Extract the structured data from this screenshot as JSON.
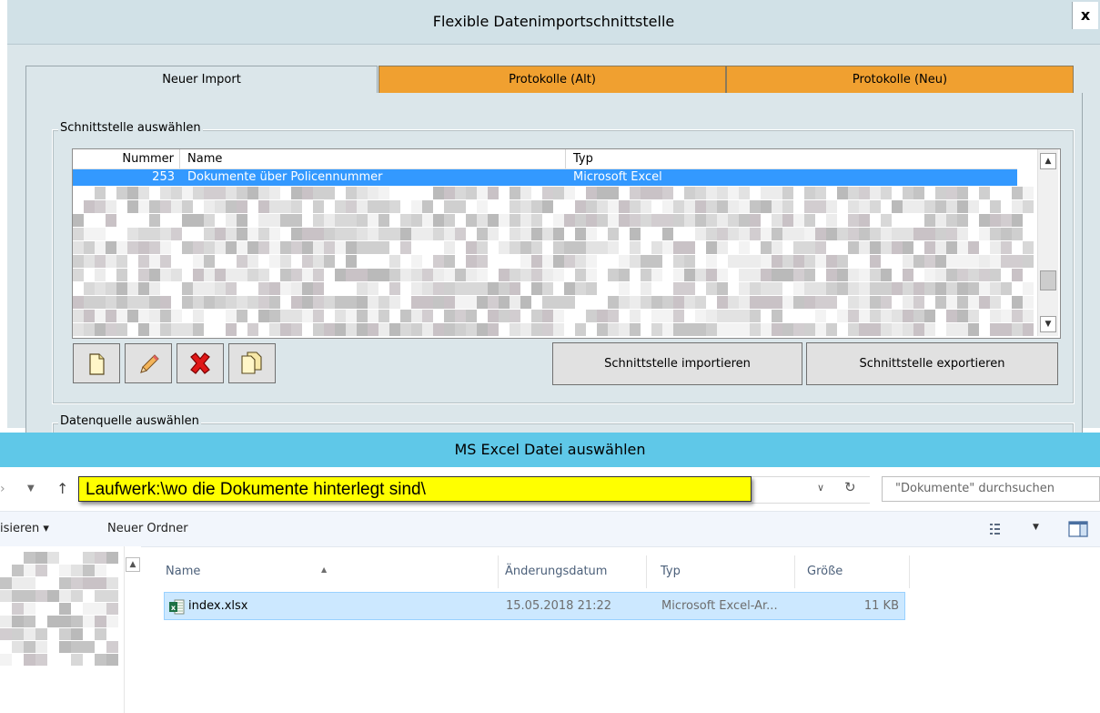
{
  "dialog": {
    "title": "Flexible Datenimportschnittstelle",
    "close_label": "x",
    "tabs": [
      {
        "label": "Neuer Import",
        "active": true
      },
      {
        "label": "Protokolle (Alt)",
        "active": false
      },
      {
        "label": "Protokolle (Neu)",
        "active": false
      }
    ],
    "interface_group": {
      "legend": "Schnittstelle auswählen",
      "columns": [
        "Nummer",
        "Name",
        "Typ"
      ],
      "selected_row": {
        "nummer": "253",
        "name": "Dokumente über Policennummer",
        "typ": "Microsoft Excel"
      },
      "buttons": {
        "new_icon": "new-document-icon",
        "edit_icon": "pencil-icon",
        "delete_icon": "red-x-icon",
        "copy_icon": "copy-document-icon",
        "import_label": "Schnittstelle importieren",
        "export_label": "Schnittstelle exportieren"
      }
    },
    "datasource_group": {
      "legend": "Datenquelle auswählen"
    }
  },
  "file_dialog": {
    "title": "MS Excel Datei auswählen",
    "address": "Laufwerk:\\wo die Dokumente hinterlegt sind\\",
    "search_placeholder": "\"Dokumente\" durchsuchen",
    "commands": {
      "organize": "isieren ▾",
      "new_folder": "Neuer Ordner"
    },
    "columns": [
      "Name",
      "Änderungsdatum",
      "Typ",
      "Größe"
    ],
    "files": [
      {
        "name": "index.xlsx",
        "date": "15.05.2018 21:22",
        "type": "Microsoft Excel-Ar...",
        "size": "11 KB",
        "selected": true
      }
    ]
  },
  "colors": {
    "tab_orange": "#f0a030",
    "selection_blue": "#3399ff",
    "file_dialog_title": "#5fc8e8",
    "address_highlight": "#ffff00"
  }
}
